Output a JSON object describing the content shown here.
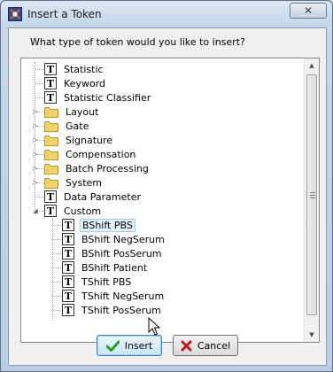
{
  "window": {
    "title": "Insert a Token",
    "close_glyph": "✕"
  },
  "prompt": "What type of token would you like to insert?",
  "tree": {
    "items": [
      {
        "label": "Statistic",
        "icon": "token-t-icon",
        "level": 0,
        "expandable": false
      },
      {
        "label": "Keyword",
        "icon": "token-t-icon",
        "level": 0,
        "expandable": false
      },
      {
        "label": "Statistic Classifier",
        "icon": "token-t-icon",
        "level": 0,
        "expandable": false
      },
      {
        "label": "Layout",
        "icon": "folder-icon",
        "level": 0,
        "expandable": true,
        "expanded": false
      },
      {
        "label": "Gate",
        "icon": "folder-icon",
        "level": 0,
        "expandable": true,
        "expanded": false
      },
      {
        "label": "Signature",
        "icon": "folder-icon",
        "level": 0,
        "expandable": true,
        "expanded": false
      },
      {
        "label": "Compensation",
        "icon": "folder-icon",
        "level": 0,
        "expandable": true,
        "expanded": false
      },
      {
        "label": "Batch Processing",
        "icon": "folder-icon",
        "level": 0,
        "expandable": true,
        "expanded": false
      },
      {
        "label": "System",
        "icon": "folder-icon",
        "level": 0,
        "expandable": true,
        "expanded": false
      },
      {
        "label": "Data Parameter",
        "icon": "token-t-icon",
        "level": 0,
        "expandable": false
      },
      {
        "label": "Custom",
        "icon": "token-t-icon",
        "level": 0,
        "expandable": true,
        "expanded": true
      },
      {
        "label": "BShift PBS",
        "icon": "token-t-icon",
        "level": 1,
        "expandable": false,
        "selected": true
      },
      {
        "label": "BShift NegSerum",
        "icon": "token-t-icon",
        "level": 1,
        "expandable": false
      },
      {
        "label": "BShift PosSerum",
        "icon": "token-t-icon",
        "level": 1,
        "expandable": false
      },
      {
        "label": "BShift Patient",
        "icon": "token-t-icon",
        "level": 1,
        "expandable": false
      },
      {
        "label": "TShift PBS",
        "icon": "token-t-icon",
        "level": 1,
        "expandable": false
      },
      {
        "label": "TShift NegSerum",
        "icon": "token-t-icon",
        "level": 1,
        "expandable": false
      },
      {
        "label": "TShift PosSerum",
        "icon": "token-t-icon",
        "level": 1,
        "expandable": false
      }
    ]
  },
  "buttons": {
    "insert_label": "Insert",
    "cancel_label": "Cancel"
  },
  "colors": {
    "selection_fill": "#e5f1fb",
    "selection_border": "#99c9ef",
    "insert_check": "#2a9a2a",
    "cancel_x": "#c0161b",
    "folder": "#f2d26b"
  }
}
